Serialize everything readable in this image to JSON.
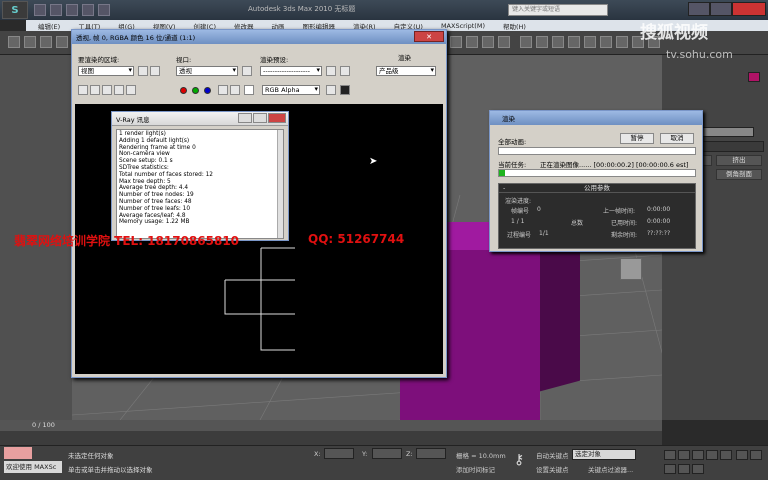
{
  "app": {
    "title": "Autodesk 3ds Max  2010      无标题",
    "search_placeholder": "键入关键字或短语",
    "logo_text": "S"
  },
  "menu": [
    "编辑(E)",
    "工具(T)",
    "组(G)",
    "视图(V)",
    "创建(C)",
    "修改器",
    "动画",
    "图形编辑器",
    "渲染(R)",
    "自定义(U)",
    "MAXScript(M)",
    "帮助(H)"
  ],
  "render_frame": {
    "title": "透视, 帧 0, RGBA 颜色 16 位/通道 (1:1)",
    "area_label": "要渲染的区域:",
    "area_value": "视图",
    "viewport_label": "视口:",
    "viewport_value": "透视",
    "preset_label": "渲染预设:",
    "preset_value": "--------------------",
    "render_label": "渲染",
    "product_value": "产品级",
    "channel_value": "RGB Alpha"
  },
  "vray": {
    "title": "V-Ray 讯息",
    "log": [
      "1 render light(s)",
      "Adding 1 default light(s)",
      "Rendering frame at time 0",
      "Non-camera view",
      "Scene setup: 0.1 s",
      "SDTree statistics:",
      "Total number of faces stored: 12",
      "Max tree depth: 5",
      "Average tree depth: 4.4",
      "Number of tree nodes: 19",
      "Number of tree faces: 48",
      "Number of tree leafs: 10",
      "Average faces/leaf: 4.8",
      "Memory usage: 1.22 MB"
    ]
  },
  "render_progress": {
    "title": "渲染",
    "pause": "暂停",
    "cancel": "取消",
    "all_anim_label": "全部动画:",
    "current_task_label": "当前任务:",
    "current_task_value": "正在渲染图像......  [00:00:00.2]  [00:00:00.6 est]",
    "params_header": "公用参数",
    "minus": "-",
    "progress_label": "渲染进度:",
    "frame_no_label": "帧编号",
    "frame_no_value": "0",
    "total_label": "总数",
    "frame_count": "1 / 1",
    "last_frame_label": "上一帧时间:",
    "last_frame_value": "0:00:00",
    "elapsed_label": "已用时间:",
    "elapsed_value": "0:00:00",
    "pass_label": "过程编号",
    "pass_value": "1/1",
    "remain_label": "剩余时间:",
    "remain_value": "??:??:??",
    "all_anim_progress": 0.0,
    "current_task_progress": 0.03
  },
  "command_panel": {
    "modifier_list": "修改器列表",
    "btn1": "车削",
    "btn2": "挤出",
    "btn3": "倒角剖面",
    "title": "Box001"
  },
  "watermark": {
    "brand": "搜狐视频",
    "url": "tv.sohu.com"
  },
  "overlay": {
    "text": "翡翠网络培训学院  TEL: 18170865810",
    "qq": "QQ: 51267744"
  },
  "status": {
    "frame_label": "0 / 100",
    "selection_text": "未选定任何对象",
    "hint_text": "单击或单击并拖动以选择对象",
    "listener_text": "欢迎使用 MAXSc",
    "x_label": "X:",
    "y_label": "Y:",
    "z_label": "Z:",
    "grid_label": "栅格 = 10.0mm",
    "add_tag": "添加时间标记",
    "auto_key": "自动关键点",
    "set_key": "设置关键点",
    "selected_dd": "选定对象",
    "key_filter": "关键点过滤器..."
  },
  "colors": {
    "object_color": "#b01366",
    "overlay_red": "#e01010",
    "progress_green": "#1fb41f"
  }
}
